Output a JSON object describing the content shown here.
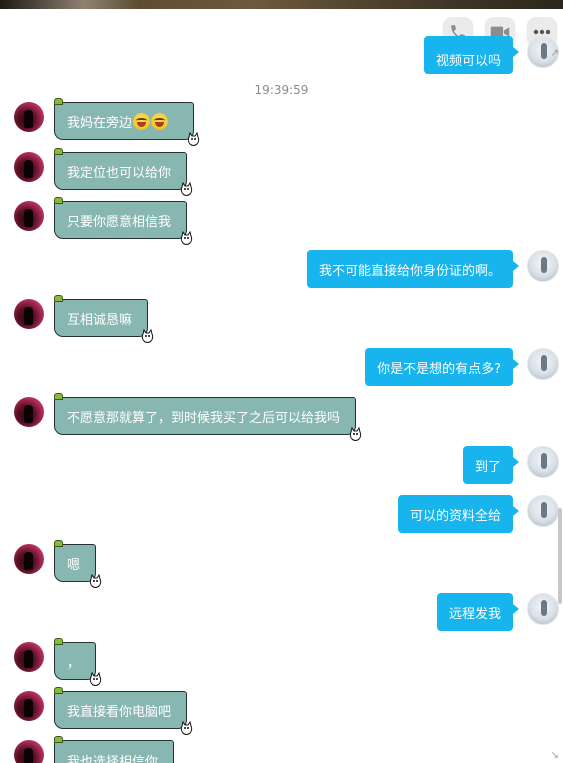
{
  "toolbar": {
    "icons": [
      "phone-icon",
      "video-call-icon",
      "more-icon"
    ],
    "icon_color": "#8c8c8c",
    "button_bg": "#ebebeb"
  },
  "chat": {
    "timestamp": "19:39:59",
    "colors": {
      "incoming_bubble": "#88b7b2",
      "outgoing_bubble": "#18b4ed",
      "bubble_text": "#ffffff"
    },
    "top_partial_message": "视频可以吗",
    "messages": [
      {
        "side": "left",
        "text": "我妈在旁边",
        "emoji": [
          "laughing-tears-emoji",
          "laughing-tears-emoji"
        ]
      },
      {
        "side": "left",
        "text": "我定位也可以给你"
      },
      {
        "side": "left",
        "text": "只要你愿意相信我"
      },
      {
        "side": "right",
        "text": "我不可能直接给你身份证的啊。"
      },
      {
        "side": "left",
        "text": "互相诚恳嘛"
      },
      {
        "side": "right",
        "text": "你是不是想的有点多?"
      },
      {
        "side": "left",
        "text": "不愿意那就算了，到时候我买了之后可以给我吗"
      },
      {
        "side": "right",
        "text": "到了"
      },
      {
        "side": "right",
        "text": "可以的资料全给"
      },
      {
        "side": "left",
        "text": "嗯"
      },
      {
        "side": "right",
        "text": "远程发我"
      },
      {
        "side": "left",
        "text": "，"
      },
      {
        "side": "left",
        "text": "我直接看你电脑吧"
      },
      {
        "side": "left",
        "text": "我也选择相信你"
      }
    ]
  }
}
